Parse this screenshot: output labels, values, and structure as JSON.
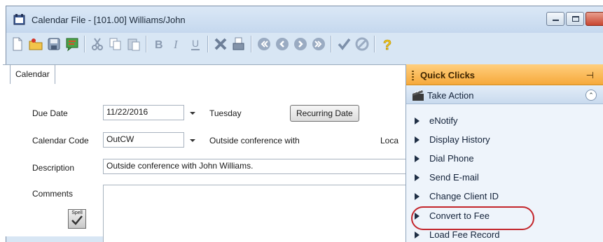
{
  "window": {
    "title": "Calendar File - [101.00] Williams/John"
  },
  "toolbar": {
    "icons": [
      "new-icon",
      "open-icon",
      "save-icon",
      "note-icon",
      "cut-icon",
      "copy-icon",
      "paste-icon",
      "bold-icon",
      "italic-icon",
      "underline-icon",
      "delete-icon",
      "print-icon",
      "first-icon",
      "previous-icon",
      "next-icon",
      "last-icon",
      "check-icon",
      "cancel-icon",
      "help-icon"
    ]
  },
  "tabs": [
    {
      "label": "Calendar"
    }
  ],
  "form": {
    "due_date_label": "Due Date",
    "due_date_value": "11/22/2016",
    "due_date_day": "Tuesday",
    "recurring_button": "Recurring Date",
    "calendar_code_label": "Calendar Code",
    "calendar_code_value": "OutCW",
    "calendar_code_desc": "Outside conference with",
    "location_label": "Loca",
    "description_label": "Description",
    "description_value": "Outside conference with John Williams.",
    "comments_label": "Comments",
    "spell_label": "Spell"
  },
  "quick_clicks": {
    "title": "Quick Clicks",
    "section_title": "Take Action",
    "items": [
      {
        "label": "eNotify"
      },
      {
        "label": "Display History"
      },
      {
        "label": "Dial Phone"
      },
      {
        "label": "Send E-mail"
      },
      {
        "label": "Change Client ID"
      },
      {
        "label": "Convert to Fee"
      },
      {
        "label": "Load Fee Record"
      }
    ],
    "highlight_color": "#c3252b"
  },
  "colors": {
    "qc_header": "#f6a93b",
    "window_frame": "#d8e6f4"
  }
}
